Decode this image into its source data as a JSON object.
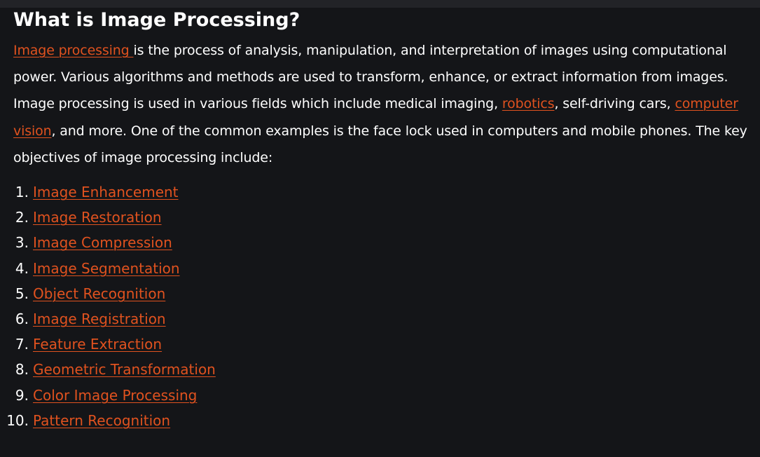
{
  "article": {
    "title": "What is Image Processing?",
    "intro": {
      "link1": "Image processing ",
      "text1": "is the process of analysis, manipulation, and interpretation of images using computational power. Various algorithms and methods are used to transform, enhance, or extract information from images. Image processing is used in various fields which include medical imaging, ",
      "link2": "robotics",
      "text2": ", self-driving cars, ",
      "link3": "computer vision",
      "text3": ", and more. One of the common examples is the face lock used in computers and mobile phones. The key objectives of image processing include:"
    },
    "objectives": [
      {
        "num": "1.",
        "label": "Image Enhancement"
      },
      {
        "num": "2.",
        "label": "Image Restoration"
      },
      {
        "num": "3.",
        "label": "Image Compression"
      },
      {
        "num": "4.",
        "label": "Image Segmentation"
      },
      {
        "num": "5.",
        "label": "Object Recognition"
      },
      {
        "num": "6.",
        "label": "Image Registration"
      },
      {
        "num": "7.",
        "label": "Feature Extraction"
      },
      {
        "num": "8.",
        "label": "Geometric Transformation"
      },
      {
        "num": "9.",
        "label": "Color Image Processing"
      },
      {
        "num": "10.",
        "label": "Pattern Recognition"
      }
    ]
  },
  "colors": {
    "background": "#141518",
    "text": "#ffffff",
    "link": "#e0521f"
  }
}
